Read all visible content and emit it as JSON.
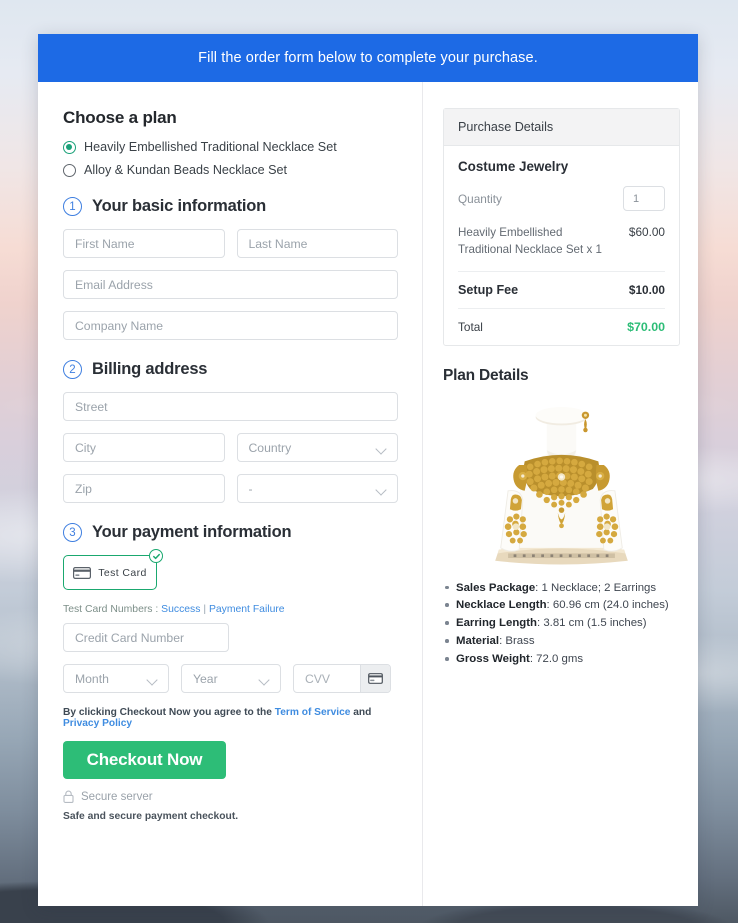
{
  "banner": {
    "text": "Fill the order form below to complete your purchase."
  },
  "plan": {
    "heading": "Choose a plan",
    "options": [
      {
        "label": "Heavily Embellished Traditional Necklace Set",
        "selected": true
      },
      {
        "label": "Alloy & Kundan Beads Necklace Set",
        "selected": false
      }
    ]
  },
  "steps": {
    "basic": {
      "num": "1",
      "title": "Your basic information"
    },
    "billing": {
      "num": "2",
      "title": "Billing address"
    },
    "payment": {
      "num": "3",
      "title": "Your payment information"
    }
  },
  "fields": {
    "first_name": "First Name",
    "last_name": "Last Name",
    "email": "Email Address",
    "company": "Company Name",
    "street": "Street",
    "city": "City",
    "country": "Country",
    "zip": "Zip",
    "state": "-",
    "credit_card": "Credit Card Number",
    "month": "Month",
    "year": "Year",
    "cvv": "CVV"
  },
  "payment": {
    "test_card_label": "Test Card",
    "test_numbers_prefix": "Test Card Numbers :",
    "success_link": "Success",
    "separator": "|",
    "failure_link": "Payment Failure"
  },
  "footer": {
    "terms_prefix": "By clicking Checkout Now you agree to the",
    "terms_link": "Term of Service",
    "terms_and": "and",
    "privacy_link": "Privacy Policy",
    "checkout_button": "Checkout Now",
    "secure_server": "Secure server",
    "safe_note": "Safe and secure payment checkout."
  },
  "purchase": {
    "heading": "Purchase Details",
    "product_name": "Costume Jewelry",
    "quantity_label": "Quantity",
    "quantity_value": "1",
    "line_item": {
      "name": "Heavily Embellished Traditional Necklace Set x 1",
      "price": "$60.00"
    },
    "setup_fee": {
      "name": "Setup Fee",
      "price": "$10.00"
    },
    "total": {
      "name": "Total",
      "price": "$70.00"
    }
  },
  "plan_details": {
    "heading": "Plan Details",
    "specs": [
      {
        "label": "Sales Package",
        "value": ": 1 Necklace; 2 Earrings"
      },
      {
        "label": "Necklace Length",
        "value": ": 60.96 cm (24.0 inches)"
      },
      {
        "label": "Earring Length",
        "value": ": 3.81 cm (1.5 inches)"
      },
      {
        "label": "Material",
        "value": ": Brass"
      },
      {
        "label": "Gross Weight",
        "value": ": 72.0 gms"
      }
    ]
  },
  "colors": {
    "banner_blue": "#1d6ae5",
    "accent_green": "#2dbd77",
    "radio_green": "#1aa179",
    "link_blue": "#3f8ce0",
    "step_blue": "#3f7fe0"
  }
}
